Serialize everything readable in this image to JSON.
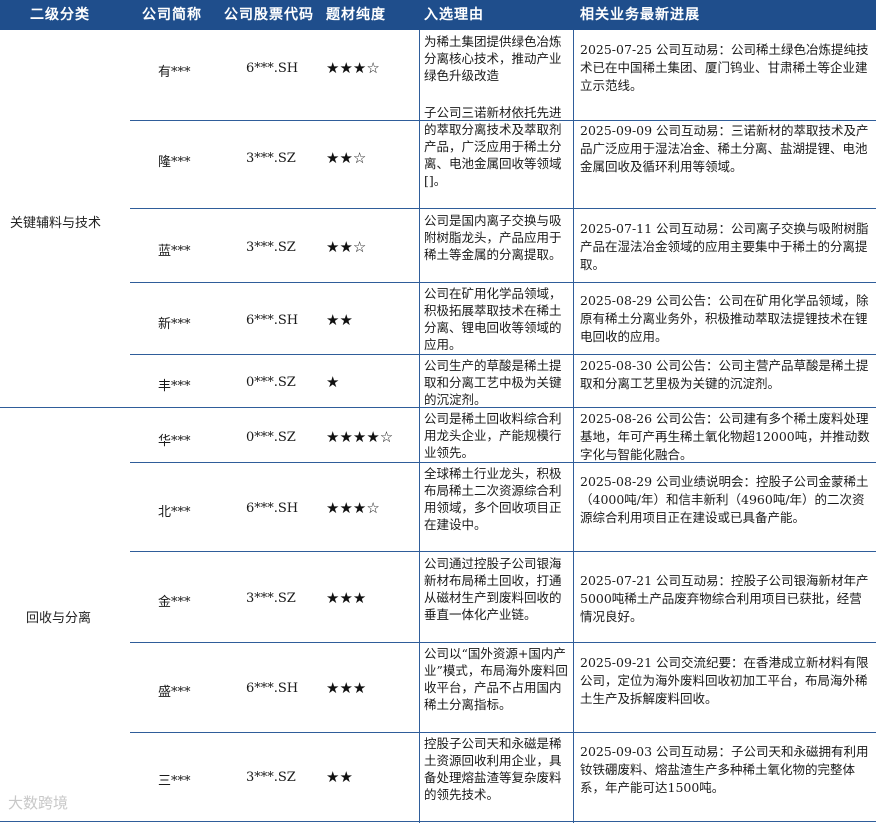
{
  "header": {
    "col_category": "二级分类",
    "col_company": "公司简称",
    "col_code": "公司股票代码",
    "col_purity": "题材纯度",
    "col_reason": "入选理由",
    "col_progress": "相关业务最新进展"
  },
  "categories": [
    {
      "name": "关键辅料与技术"
    },
    {
      "name": "回收与分离"
    }
  ],
  "rows": [
    {
      "company": "有***",
      "code": "6***.SH",
      "stars": "★★★☆",
      "reason": "为稀土集团提供绿色冶炼分离核心技术，推动产业绿色升级改造",
      "progress": "2025-07-25 公司互动易：公司稀土绿色冶炼提纯技术已在中国稀土集团、厦门钨业、甘肃稀土等企业建立示范线。"
    },
    {
      "company": "隆***",
      "code": "3***.SZ",
      "stars": "★★☆",
      "reason": "子公司三诺新材依托先进的萃取分离技术及萃取剂产品，广泛应用于稀土分离、电池金属回收等领域[]。",
      "progress": "2025-09-09 公司互动易：三诺新材的萃取技术及产品广泛应用于湿法冶金、稀土分离、盐湖提锂、电池金属回收及循环利用等领域。"
    },
    {
      "company": "蓝***",
      "code": "3***.SZ",
      "stars": "★★☆",
      "reason": "公司是国内离子交换与吸附树脂龙头，产品应用于稀土等金属的分离提取。",
      "progress": "2025-07-11 公司互动易：公司离子交换与吸附树脂产品在湿法冶金领域的应用主要集中于稀土的分离提取。"
    },
    {
      "company": "新***",
      "code": "6***.SH",
      "stars": "★★",
      "reason": "公司在矿用化学品领域，积极拓展萃取技术在稀土分离、锂电回收等领域的应用。",
      "progress": "2025-08-29 公司公告：公司在矿用化学品领域，除原有稀土分离业务外，积极推动萃取法提锂技术在锂电回收的应用。"
    },
    {
      "company": "丰***",
      "code": "0***.SZ",
      "stars": "★",
      "reason": "公司生产的草酸是稀土提取和分离工艺中极为关键的沉淀剂。",
      "progress": "2025-08-30 公司公告：公司主营产品草酸是稀土提取和分离工艺里极为关键的沉淀剂。"
    },
    {
      "company": "华***",
      "code": "0***.SZ",
      "stars": "★★★★☆",
      "reason": "公司是稀土回收料综合利用龙头企业，产能规模行业领先。",
      "progress": "2025-08-26 公司公告：公司建有多个稀土废料处理基地，年可产再生稀土氧化物超12000吨，并推动数字化与智能化融合。"
    },
    {
      "company": "北***",
      "code": "6***.SH",
      "stars": "★★★☆",
      "reason": "全球稀土行业龙头，积极布局稀土二次资源综合利用领域，多个回收项目正在建设中。",
      "progress": "2025-08-29 公司业绩说明会：控股子公司金蒙稀土（4000吨/年）和信丰新利（4960吨/年）的二次资源综合利用项目正在建设或已具备产能。"
    },
    {
      "company": "金***",
      "code": "3***.SZ",
      "stars": "★★★",
      "reason": "公司通过控股子公司银海新材布局稀土回收，打通从磁材生产到废料回收的垂直一体化产业链。",
      "progress": "2025-07-21 公司互动易：控股子公司银海新材年产5000吨稀土产品废弃物综合利用项目已获批，经营情况良好。"
    },
    {
      "company": "盛***",
      "code": "6***.SH",
      "stars": "★★★",
      "reason": "公司以“国外资源+国内产业”模式，布局海外废料回收平台，产品不占用国内稀土分离指标。",
      "progress": "2025-09-21 公司交流纪要：在香港成立新材料有限公司，定位为海外废料回收初加工平台，布局海外稀土生产及拆解废料回收。"
    },
    {
      "company": "三***",
      "code": "3***.SZ",
      "stars": "★★",
      "reason": "控股子公司天和永磁是稀土资源回收利用企业，具备处理熔盐渣等复杂废料的领先技术。",
      "progress": "2025-09-03 公司互动易：子公司天和永磁拥有利用钕铁硼废料、熔盐渣生产多种稀土氧化物的完整体系，年产能可达1500吨。"
    }
  ],
  "watermark": "大数跨境"
}
